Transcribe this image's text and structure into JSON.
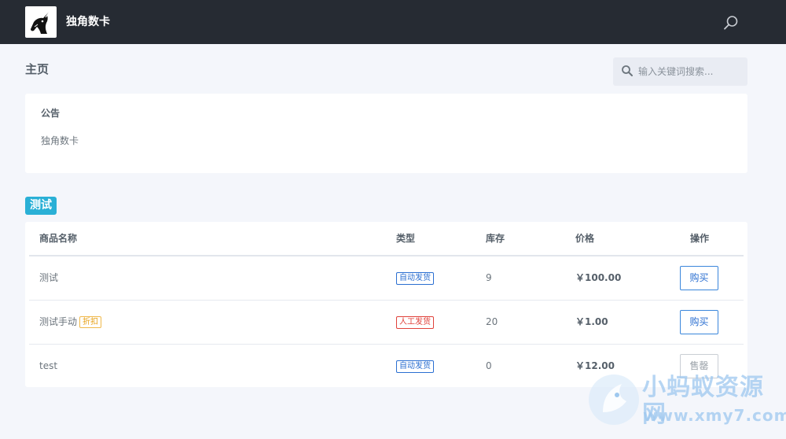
{
  "header": {
    "brand": "独角数卡",
    "logo_icon": "unicorn-logo",
    "search_icon": "search-icon"
  },
  "page": {
    "title": "主页"
  },
  "search": {
    "placeholder": "输入关键词搜索..."
  },
  "notice": {
    "title": "公告",
    "body": "独角数卡"
  },
  "category": {
    "label": "测试"
  },
  "table": {
    "headers": {
      "name": "商品名称",
      "type": "类型",
      "stock": "库存",
      "price": "价格",
      "action": "操作"
    },
    "rows": [
      {
        "name": "测试",
        "badge": "",
        "type": "自动发货",
        "type_kind": "auto",
        "stock": "9",
        "price": "￥100.00",
        "action": "购买",
        "action_enabled": true
      },
      {
        "name": "测试手动",
        "badge": "折扣",
        "type": "人工发货",
        "type_kind": "manual",
        "stock": "20",
        "price": "￥1.00",
        "action": "购买",
        "action_enabled": true
      },
      {
        "name": "test",
        "badge": "",
        "type": "自动发货",
        "type_kind": "auto",
        "stock": "0",
        "price": "￥12.00",
        "action": "售罄",
        "action_enabled": false
      }
    ]
  },
  "watermark": {
    "line1": "小蚂蚁资源网",
    "line2": "www.xmy7.com"
  },
  "colors": {
    "topbar": "#262b33",
    "category_badge": "#2ab0d6",
    "auto_tag": "#2b6fd1",
    "manual_tag": "#e0423b",
    "discount_tag": "#e7a21a",
    "watermark": "#9ec8ef"
  }
}
